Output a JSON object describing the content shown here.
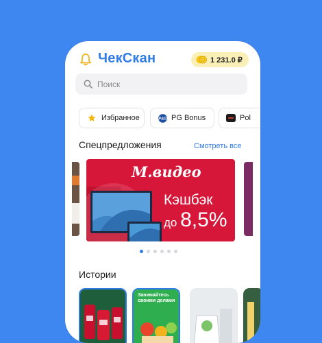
{
  "header": {
    "title": "ЧекСкан",
    "balance": "1 231.0 ₽"
  },
  "search": {
    "placeholder": "Поиск"
  },
  "chips": [
    {
      "label": "Избранное",
      "icon": "star-icon"
    },
    {
      "label": "PG Bonus",
      "icon": "pg-logo-icon"
    },
    {
      "label": "Pol",
      "icon": "brand-logo-icon"
    }
  ],
  "offers": {
    "title": "Спецпредложения",
    "see_all": "Смотреть все",
    "promo": {
      "brand": "М.видео",
      "line1": "Кэшбэк",
      "prefix": "до",
      "value": "8,5%"
    },
    "dots_total": 6,
    "dots_active": 1
  },
  "stories": {
    "title": "Истории",
    "items": [
      {
        "text": ""
      },
      {
        "text": "Занимайтесь своими делами"
      },
      {
        "text": ""
      },
      {
        "text": ""
      }
    ]
  },
  "colors": {
    "background": "#3f87f0",
    "accent": "#2f7be8",
    "promo_red": "#d6173a",
    "balance_pill": "#fbefb8"
  }
}
